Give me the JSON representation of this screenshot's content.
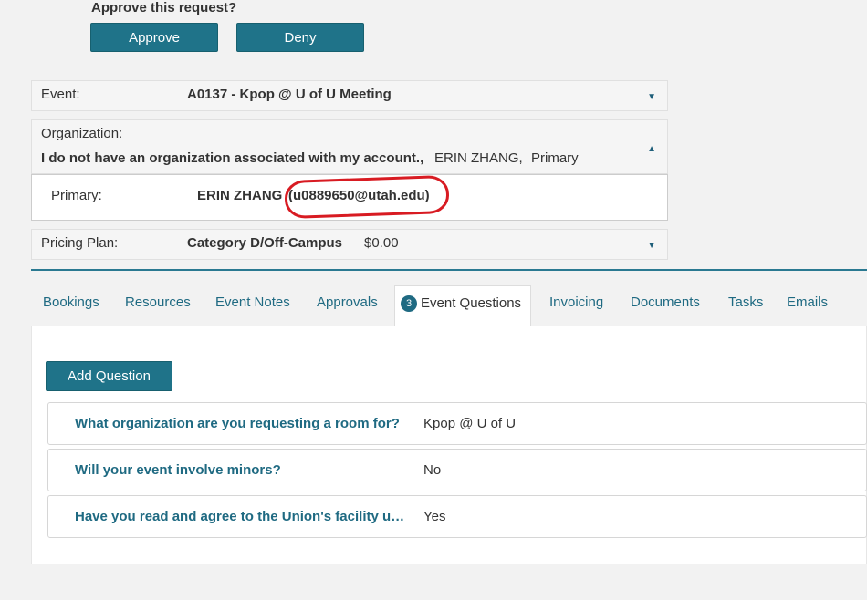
{
  "approval": {
    "title": "Approve this request?",
    "approve_label": "Approve",
    "deny_label": "Deny"
  },
  "event": {
    "label": "Event:",
    "value": "A0137 - Kpop @ U of U Meeting"
  },
  "organization": {
    "label": "Organization:",
    "name": "I do not have an organization associated with my account.,",
    "contact": "ERIN ZHANG,",
    "role": "Primary"
  },
  "primary": {
    "label": "Primary:",
    "name": "ERIN ZHANG",
    "email": "(u0889650@utah.edu)"
  },
  "pricing": {
    "label": "Pricing Plan:",
    "plan": "Category D/Off-Campus",
    "amount": "$0.00"
  },
  "tabs": [
    {
      "label": "Bookings"
    },
    {
      "label": "Resources"
    },
    {
      "label": "Event Notes"
    },
    {
      "label": "Approvals"
    },
    {
      "label": "Event Questions",
      "badge": "3",
      "active": true
    },
    {
      "label": "Invoicing"
    },
    {
      "label": "Documents"
    },
    {
      "label": "Tasks"
    },
    {
      "label": "Emails"
    }
  ],
  "questions": {
    "add_label": "Add Question",
    "items": [
      {
        "q": "What organization are you requesting a room for?",
        "a": "Kpop @ U of U"
      },
      {
        "q": "Will your event involve minors?",
        "a": "No"
      },
      {
        "q": "Have you read and agree to the Union's facility use policy?",
        "a": "Yes"
      }
    ]
  },
  "colors": {
    "accent": "#1f7389",
    "link": "#1f6a82",
    "annotation": "#d81b22"
  }
}
